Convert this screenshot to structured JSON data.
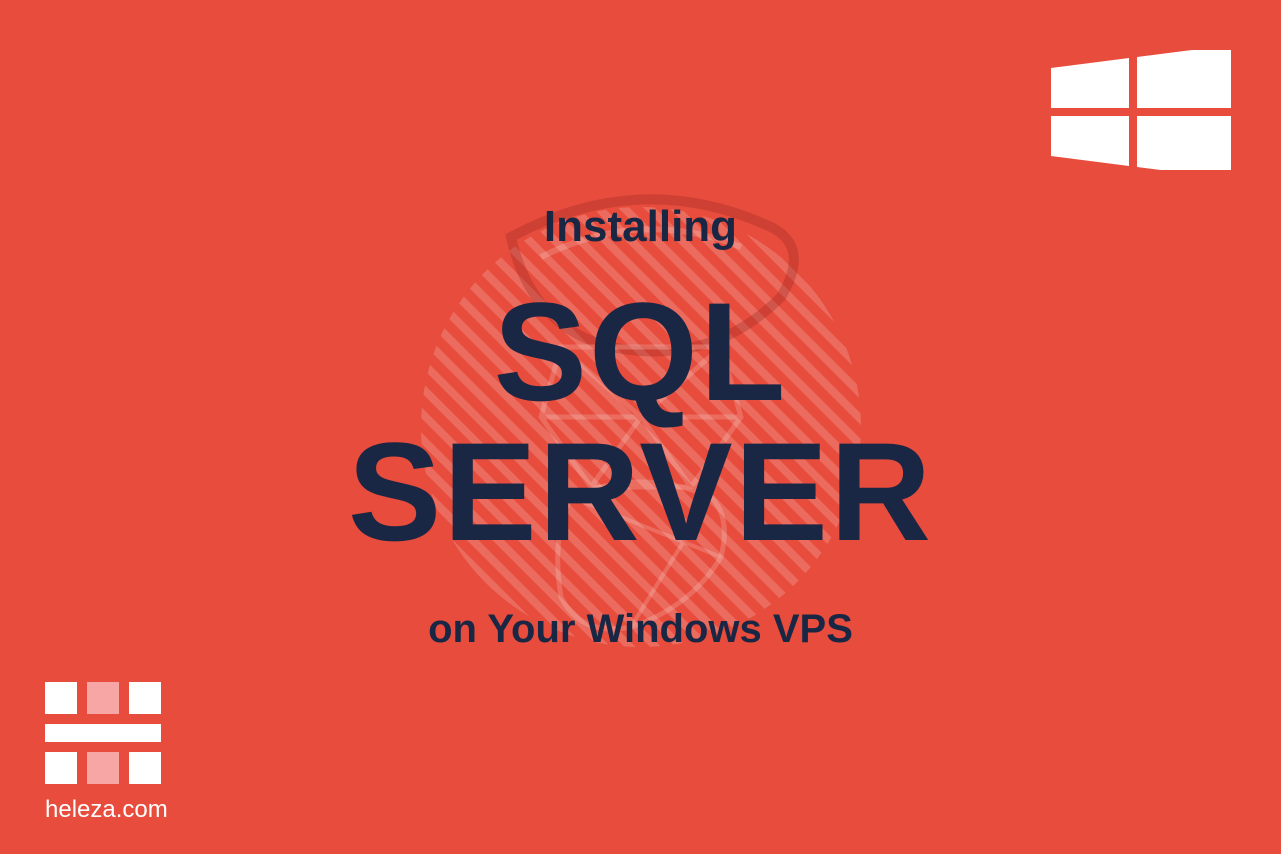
{
  "header": {
    "title_top": "Installing",
    "title_main_line1": "SQL",
    "title_main_line2": "SERVER",
    "title_bottom": "on Your Windows VPS"
  },
  "branding": {
    "site_url": "heleza.com"
  },
  "colors": {
    "background": "#e74c3c",
    "text_dark": "#1a2744",
    "text_light": "#ffffff"
  }
}
